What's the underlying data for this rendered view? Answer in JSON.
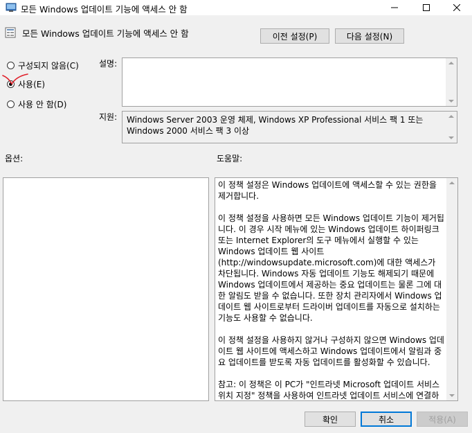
{
  "window": {
    "title": "모든 Windows 업데이트 기능에 액세스 안 함",
    "icons": {
      "app": "policy-settings-icon",
      "minimize": "minimize-icon",
      "maximize": "maximize-icon",
      "close": "close-icon"
    }
  },
  "header": {
    "title": "모든 Windows 업데이트 기능에 액세스 안 함",
    "prev_label": "이전 설정(P)",
    "next_label": "다음 설정(N)"
  },
  "state": {
    "options": [
      {
        "label": "구성되지 않음(C)",
        "checked": false
      },
      {
        "label": "사용(E)",
        "checked": true
      },
      {
        "label": "사용 안 함(D)",
        "checked": false
      }
    ]
  },
  "comment": {
    "label": "설명:",
    "value": ""
  },
  "supported": {
    "label": "지원:",
    "value": "Windows Server 2003 운영 체제, Windows XP Professional 서비스 팩 1 또는 Windows 2000 서비스 팩 3 이상"
  },
  "options_section": {
    "label": "옵션:"
  },
  "help_section": {
    "label": "도움말:",
    "paragraphs": [
      "이 정책 설정은 Windows 업데이트에 액세스할 수 있는 권한을 제거합니다.",
      "이 정책 설정을 사용하면 모든 Windows 업데이트 기능이 제거됩니다. 이 경우 시작 메뉴에 있는 Windows 업데이트 하이퍼링크 또는 Internet Explorer의 도구 메뉴에서 실행할 수 있는 Windows 업데이트 웹 사이트(http://windowsupdate.microsoft.com)에 대한 액세스가 차단됩니다. Windows 자동 업데이트 기능도 해제되기 때문에 Windows 업데이트에서 제공하는 중요 업데이트는 물론 그에 대한 알림도 받을 수 없습니다. 또한 장치 관리자에서 Windows 업데이트 웹 사이트로부터 드라이버 업데이트를 자동으로 설치하는 기능도 사용할 수 없습니다.",
      "이 정책 설정을 사용하지 않거나 구성하지 않으면 Windows 업데이트 웹 사이트에 액세스하고 Windows 업데이트에서 알림과 중요 업데이트를 받도록 자동 업데이트를 활성화할 수 있습니다.",
      "참고: 이 정책은 이 PC가 \"인트라넷 Microsoft 업데이트 서비스 위치 지정\" 정책을 사용하여 인트라넷 업데이트 서비스에 연결하도록 구성된 경우에만 적용됩니다."
    ]
  },
  "footer": {
    "ok_label": "확인",
    "cancel_label": "취소",
    "apply_label": "적용(A)"
  },
  "colors": {
    "accent": "#0078d7",
    "annotation": "#e0202a"
  }
}
